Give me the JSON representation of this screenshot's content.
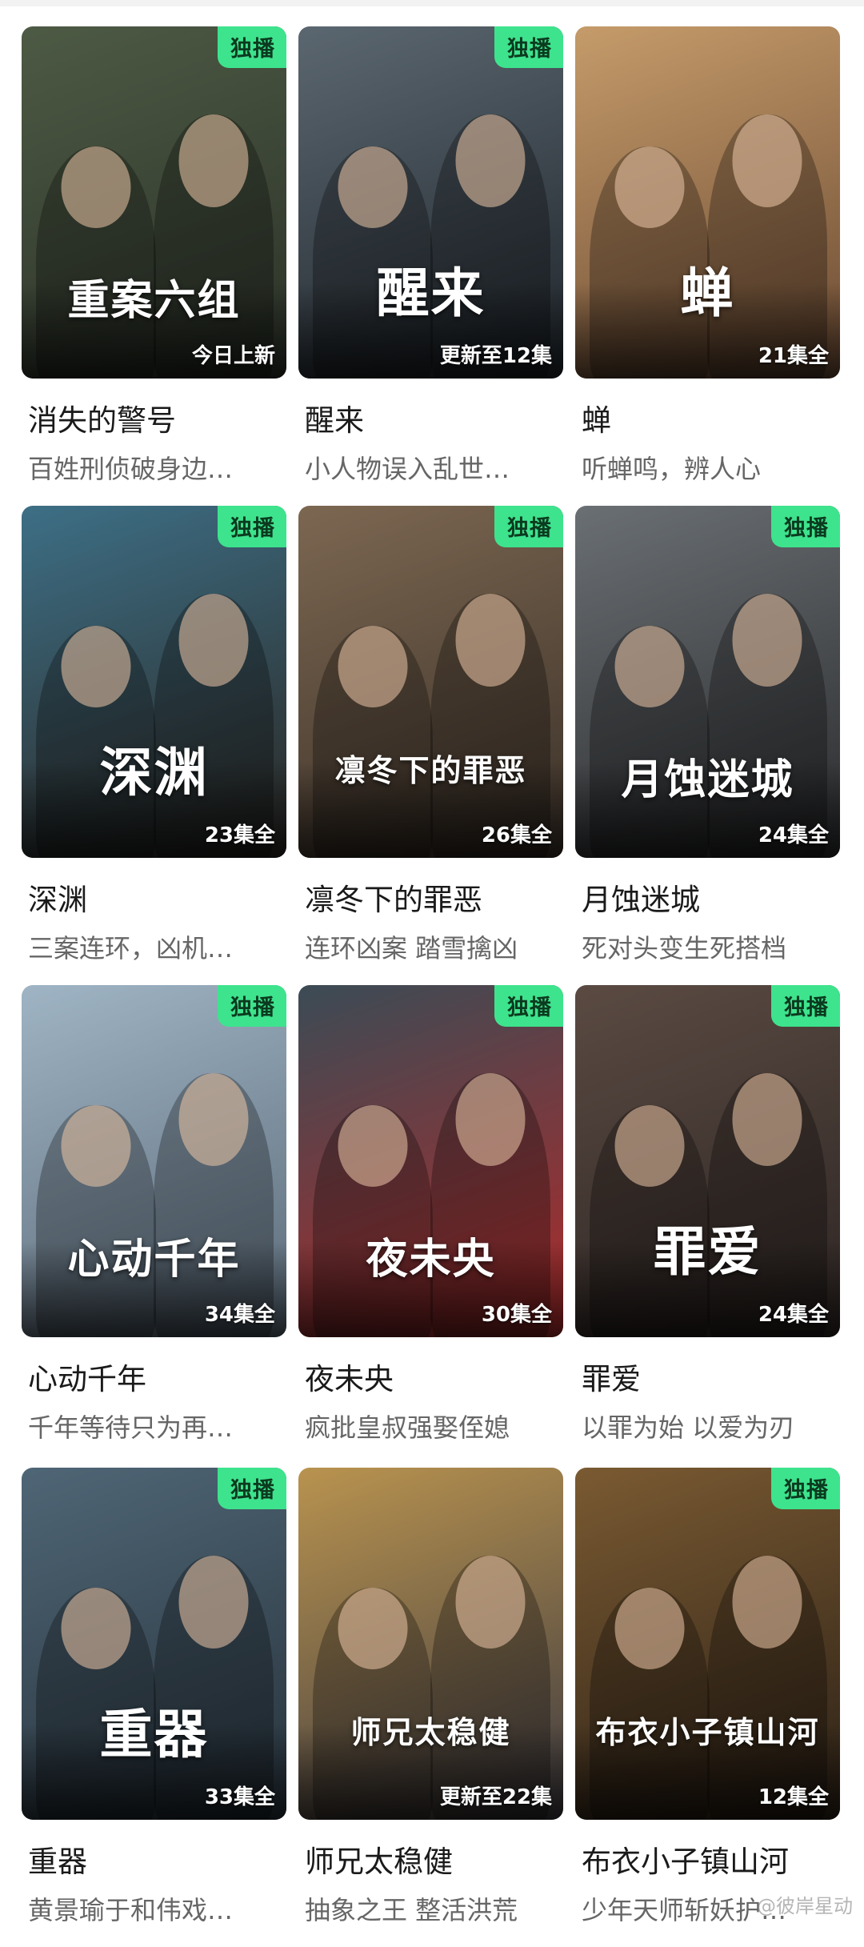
{
  "badge_label": "独播",
  "colors": {
    "badge_bg": "#3ee38d",
    "status_text": "#ffffff"
  },
  "cards": [
    {
      "title": "消失的警号",
      "desc": "百姓刑侦破身边…",
      "status": "今日上新",
      "logo": "重案六组",
      "exclusive": true,
      "bg": [
        "#4d5a44",
        "#2b3128"
      ]
    },
    {
      "title": "醒来",
      "desc": "小人物误入乱世…",
      "status": "更新至12集",
      "logo": "醒来",
      "exclusive": true,
      "bg": [
        "#5b6770",
        "#1f252b"
      ]
    },
    {
      "title": "蝉",
      "desc": "听蝉鸣，辨人心",
      "status": "21集全",
      "logo": "蝉",
      "exclusive": false,
      "bg": [
        "#c59b6a",
        "#6b4a33"
      ]
    },
    {
      "title": "深渊",
      "desc": "三案连环，凶机…",
      "status": "23集全",
      "logo": "深渊",
      "exclusive": true,
      "bg": [
        "#3d6f86",
        "#2a2622"
      ]
    },
    {
      "title": "凛冬下的罪恶",
      "desc": "连环凶案 踏雪擒凶",
      "status": "26集全",
      "logo": "凛冬下的罪恶",
      "exclusive": true,
      "bg": [
        "#7c6751",
        "#3a3028"
      ]
    },
    {
      "title": "月蚀迷城",
      "desc": "死对头变生死搭档",
      "status": "24集全",
      "logo": "月蚀迷城",
      "exclusive": true,
      "bg": [
        "#6a6f73",
        "#2a2b2d"
      ]
    },
    {
      "title": "心动千年",
      "desc": "千年等待只为再…",
      "status": "34集全",
      "logo": "心动千年",
      "exclusive": true,
      "bg": [
        "#9fb4c4",
        "#5b6a78"
      ]
    },
    {
      "title": "夜未央",
      "desc": "疯批皇叔强娶侄媳",
      "status": "30集全",
      "logo": "夜未央",
      "exclusive": true,
      "bg": [
        "#3b4b55",
        "#b02a2a"
      ]
    },
    {
      "title": "罪爱",
      "desc": "以罪为始 以爱为刃",
      "status": "24集全",
      "logo": "罪爱",
      "exclusive": true,
      "bg": [
        "#5a4a42",
        "#2d2523"
      ]
    },
    {
      "title": "重器",
      "desc": "黄景瑜于和伟戏…",
      "status": "33集全",
      "logo": "重器",
      "exclusive": true,
      "bg": [
        "#4f6676",
        "#27323b"
      ]
    },
    {
      "title": "师兄太稳健",
      "desc": "抽象之王 整活洪荒",
      "status": "更新至22集",
      "logo": "师兄太稳健",
      "exclusive": false,
      "bg": [
        "#b9934f",
        "#3d3a40"
      ]
    },
    {
      "title": "布衣小子镇山河",
      "desc": "少年天师斩妖护…",
      "status": "12集全",
      "logo": "布衣小子镇山河",
      "exclusive": true,
      "bg": [
        "#7a5a32",
        "#2b2016"
      ]
    }
  ],
  "watermark": "@彼岸星动"
}
